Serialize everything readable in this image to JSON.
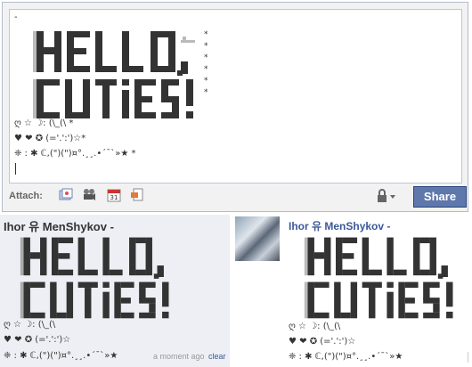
{
  "composer": {
    "art_lines": [
      "▓▓▓▓▓▓▓ ▓▓ ▓▓▓▓▓ ▓▓  ▓▓   ▓▓▓▓ ▒__",
      "▓▓▓▓▓▓▓ ▓▓▓▓  ▓▓▓▓▓▓▓ ▓▓ ▓▓▓▓▓▓",
      "▓▓▓▓▓▓ ▓▓ ▓▓▓▓▓ ▓▓▓▓ ▓▓▓▓ ▓▓▓▓▓▓",
      "▓▓▓▓▓▓ ▓▓▓▓ ▓▓▓▓▓▓▓ ▓▓▓▓▓▓▓ ▓▓ ▓▓"
    ],
    "deco_lines": [
      "ღ ☆ ☽: (\\_(\\ *",
      "♥ ❤ ✪ (='.':')☆*",
      "❈ : ✱ ℂ,(\")(\")¤°.¸¸.•´¯`»★ *"
    ],
    "dash": "-",
    "stars": [
      "*",
      "*",
      "*",
      "*",
      "*",
      "*"
    ]
  },
  "attach": {
    "label": "Attach:",
    "icons": [
      "photo-icon",
      "video-icon",
      "event-icon",
      "link-icon"
    ]
  },
  "privacy": {
    "icon": "lock-icon"
  },
  "share_label": "Share",
  "post_left": {
    "author": "Ihor 유 MenShykov -",
    "deco_lines": [
      "ღ ☆ ☽: (\\_(\\",
      "♥ ❤ ✪ (='.':')☆",
      "❈ : ✱ ℂ,(\")(\")¤°.¸¸.•´¯`»★"
    ],
    "timestamp": "a moment ago",
    "clear": "clear"
  },
  "post_right": {
    "author": "Ihor 유 MenShykov -",
    "deco_lines": [
      "ღ ☆ ☽: (\\_(\\",
      "♥ ❤ ✪ (='.':')☆",
      "❈ : ✱ ℂ,(\")(\")¤°.¸¸.•´¯`»★"
    ]
  },
  "colors": {
    "share_bg": "#5f78ab",
    "link": "#3b5998",
    "post_bg": "#edeff4",
    "block": "#333333"
  }
}
